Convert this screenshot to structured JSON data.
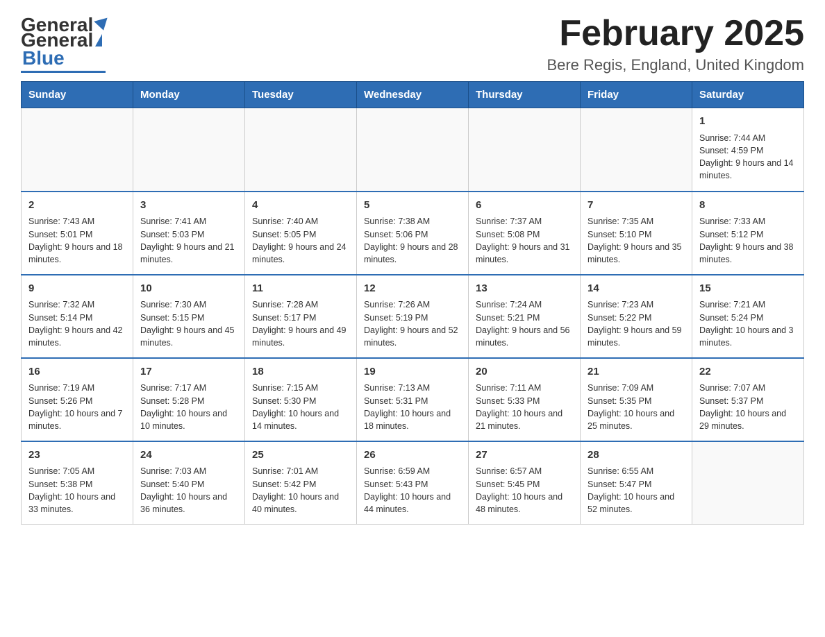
{
  "header": {
    "logo_general": "General",
    "logo_blue": "Blue",
    "title": "February 2025",
    "subtitle": "Bere Regis, England, United Kingdom"
  },
  "days_of_week": [
    "Sunday",
    "Monday",
    "Tuesday",
    "Wednesday",
    "Thursday",
    "Friday",
    "Saturday"
  ],
  "weeks": [
    {
      "days": [
        {
          "number": "",
          "sunrise": "",
          "sunset": "",
          "daylight": "",
          "empty": true
        },
        {
          "number": "",
          "sunrise": "",
          "sunset": "",
          "daylight": "",
          "empty": true
        },
        {
          "number": "",
          "sunrise": "",
          "sunset": "",
          "daylight": "",
          "empty": true
        },
        {
          "number": "",
          "sunrise": "",
          "sunset": "",
          "daylight": "",
          "empty": true
        },
        {
          "number": "",
          "sunrise": "",
          "sunset": "",
          "daylight": "",
          "empty": true
        },
        {
          "number": "",
          "sunrise": "",
          "sunset": "",
          "daylight": "",
          "empty": true
        },
        {
          "number": "1",
          "sunrise": "Sunrise: 7:44 AM",
          "sunset": "Sunset: 4:59 PM",
          "daylight": "Daylight: 9 hours and 14 minutes.",
          "empty": false
        }
      ]
    },
    {
      "days": [
        {
          "number": "2",
          "sunrise": "Sunrise: 7:43 AM",
          "sunset": "Sunset: 5:01 PM",
          "daylight": "Daylight: 9 hours and 18 minutes.",
          "empty": false
        },
        {
          "number": "3",
          "sunrise": "Sunrise: 7:41 AM",
          "sunset": "Sunset: 5:03 PM",
          "daylight": "Daylight: 9 hours and 21 minutes.",
          "empty": false
        },
        {
          "number": "4",
          "sunrise": "Sunrise: 7:40 AM",
          "sunset": "Sunset: 5:05 PM",
          "daylight": "Daylight: 9 hours and 24 minutes.",
          "empty": false
        },
        {
          "number": "5",
          "sunrise": "Sunrise: 7:38 AM",
          "sunset": "Sunset: 5:06 PM",
          "daylight": "Daylight: 9 hours and 28 minutes.",
          "empty": false
        },
        {
          "number": "6",
          "sunrise": "Sunrise: 7:37 AM",
          "sunset": "Sunset: 5:08 PM",
          "daylight": "Daylight: 9 hours and 31 minutes.",
          "empty": false
        },
        {
          "number": "7",
          "sunrise": "Sunrise: 7:35 AM",
          "sunset": "Sunset: 5:10 PM",
          "daylight": "Daylight: 9 hours and 35 minutes.",
          "empty": false
        },
        {
          "number": "8",
          "sunrise": "Sunrise: 7:33 AM",
          "sunset": "Sunset: 5:12 PM",
          "daylight": "Daylight: 9 hours and 38 minutes.",
          "empty": false
        }
      ]
    },
    {
      "days": [
        {
          "number": "9",
          "sunrise": "Sunrise: 7:32 AM",
          "sunset": "Sunset: 5:14 PM",
          "daylight": "Daylight: 9 hours and 42 minutes.",
          "empty": false
        },
        {
          "number": "10",
          "sunrise": "Sunrise: 7:30 AM",
          "sunset": "Sunset: 5:15 PM",
          "daylight": "Daylight: 9 hours and 45 minutes.",
          "empty": false
        },
        {
          "number": "11",
          "sunrise": "Sunrise: 7:28 AM",
          "sunset": "Sunset: 5:17 PM",
          "daylight": "Daylight: 9 hours and 49 minutes.",
          "empty": false
        },
        {
          "number": "12",
          "sunrise": "Sunrise: 7:26 AM",
          "sunset": "Sunset: 5:19 PM",
          "daylight": "Daylight: 9 hours and 52 minutes.",
          "empty": false
        },
        {
          "number": "13",
          "sunrise": "Sunrise: 7:24 AM",
          "sunset": "Sunset: 5:21 PM",
          "daylight": "Daylight: 9 hours and 56 minutes.",
          "empty": false
        },
        {
          "number": "14",
          "sunrise": "Sunrise: 7:23 AM",
          "sunset": "Sunset: 5:22 PM",
          "daylight": "Daylight: 9 hours and 59 minutes.",
          "empty": false
        },
        {
          "number": "15",
          "sunrise": "Sunrise: 7:21 AM",
          "sunset": "Sunset: 5:24 PM",
          "daylight": "Daylight: 10 hours and 3 minutes.",
          "empty": false
        }
      ]
    },
    {
      "days": [
        {
          "number": "16",
          "sunrise": "Sunrise: 7:19 AM",
          "sunset": "Sunset: 5:26 PM",
          "daylight": "Daylight: 10 hours and 7 minutes.",
          "empty": false
        },
        {
          "number": "17",
          "sunrise": "Sunrise: 7:17 AM",
          "sunset": "Sunset: 5:28 PM",
          "daylight": "Daylight: 10 hours and 10 minutes.",
          "empty": false
        },
        {
          "number": "18",
          "sunrise": "Sunrise: 7:15 AM",
          "sunset": "Sunset: 5:30 PM",
          "daylight": "Daylight: 10 hours and 14 minutes.",
          "empty": false
        },
        {
          "number": "19",
          "sunrise": "Sunrise: 7:13 AM",
          "sunset": "Sunset: 5:31 PM",
          "daylight": "Daylight: 10 hours and 18 minutes.",
          "empty": false
        },
        {
          "number": "20",
          "sunrise": "Sunrise: 7:11 AM",
          "sunset": "Sunset: 5:33 PM",
          "daylight": "Daylight: 10 hours and 21 minutes.",
          "empty": false
        },
        {
          "number": "21",
          "sunrise": "Sunrise: 7:09 AM",
          "sunset": "Sunset: 5:35 PM",
          "daylight": "Daylight: 10 hours and 25 minutes.",
          "empty": false
        },
        {
          "number": "22",
          "sunrise": "Sunrise: 7:07 AM",
          "sunset": "Sunset: 5:37 PM",
          "daylight": "Daylight: 10 hours and 29 minutes.",
          "empty": false
        }
      ]
    },
    {
      "days": [
        {
          "number": "23",
          "sunrise": "Sunrise: 7:05 AM",
          "sunset": "Sunset: 5:38 PM",
          "daylight": "Daylight: 10 hours and 33 minutes.",
          "empty": false
        },
        {
          "number": "24",
          "sunrise": "Sunrise: 7:03 AM",
          "sunset": "Sunset: 5:40 PM",
          "daylight": "Daylight: 10 hours and 36 minutes.",
          "empty": false
        },
        {
          "number": "25",
          "sunrise": "Sunrise: 7:01 AM",
          "sunset": "Sunset: 5:42 PM",
          "daylight": "Daylight: 10 hours and 40 minutes.",
          "empty": false
        },
        {
          "number": "26",
          "sunrise": "Sunrise: 6:59 AM",
          "sunset": "Sunset: 5:43 PM",
          "daylight": "Daylight: 10 hours and 44 minutes.",
          "empty": false
        },
        {
          "number": "27",
          "sunrise": "Sunrise: 6:57 AM",
          "sunset": "Sunset: 5:45 PM",
          "daylight": "Daylight: 10 hours and 48 minutes.",
          "empty": false
        },
        {
          "number": "28",
          "sunrise": "Sunrise: 6:55 AM",
          "sunset": "Sunset: 5:47 PM",
          "daylight": "Daylight: 10 hours and 52 minutes.",
          "empty": false
        },
        {
          "number": "",
          "sunrise": "",
          "sunset": "",
          "daylight": "",
          "empty": true
        }
      ]
    }
  ]
}
